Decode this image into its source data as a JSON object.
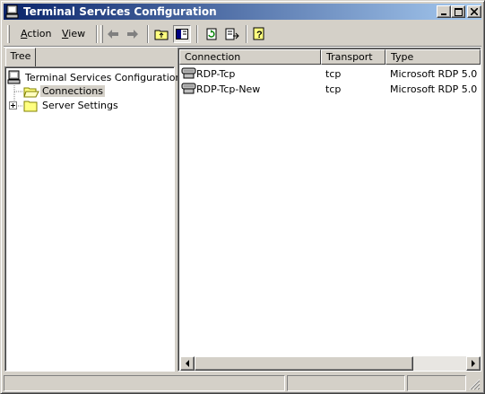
{
  "window": {
    "title": "Terminal Services Configuration",
    "title_gradient_start": "#0a246a",
    "title_gradient_end": "#a6caf0",
    "controls": [
      "minimize-icon",
      "maximize-icon",
      "close-icon"
    ]
  },
  "menu": {
    "action_label": "Action",
    "view_label": "View"
  },
  "toolbar": {
    "icons": [
      "back-arrow-icon",
      "forward-arrow-icon",
      "up-one-level-icon",
      "show-hide-tree-icon",
      "refresh-icon",
      "export-list-icon",
      "help-icon"
    ]
  },
  "tree": {
    "tab_label": "Tree",
    "root_label": "Terminal Services Configuration",
    "nodes": [
      {
        "label": "Connections",
        "selected": true
      },
      {
        "label": "Server Settings",
        "selected": false
      }
    ]
  },
  "list": {
    "columns": [
      "Connection",
      "Transport",
      "Type"
    ],
    "rows": [
      {
        "connection": "RDP-Tcp",
        "transport": "tcp",
        "type": "Microsoft RDP 5.0"
      },
      {
        "connection": "RDP-Tcp-New",
        "transport": "tcp",
        "type": "Microsoft RDP 5.0"
      }
    ]
  },
  "colors": {
    "selection_highlight": "#d4d0c8",
    "face": "#d4d0c8"
  }
}
